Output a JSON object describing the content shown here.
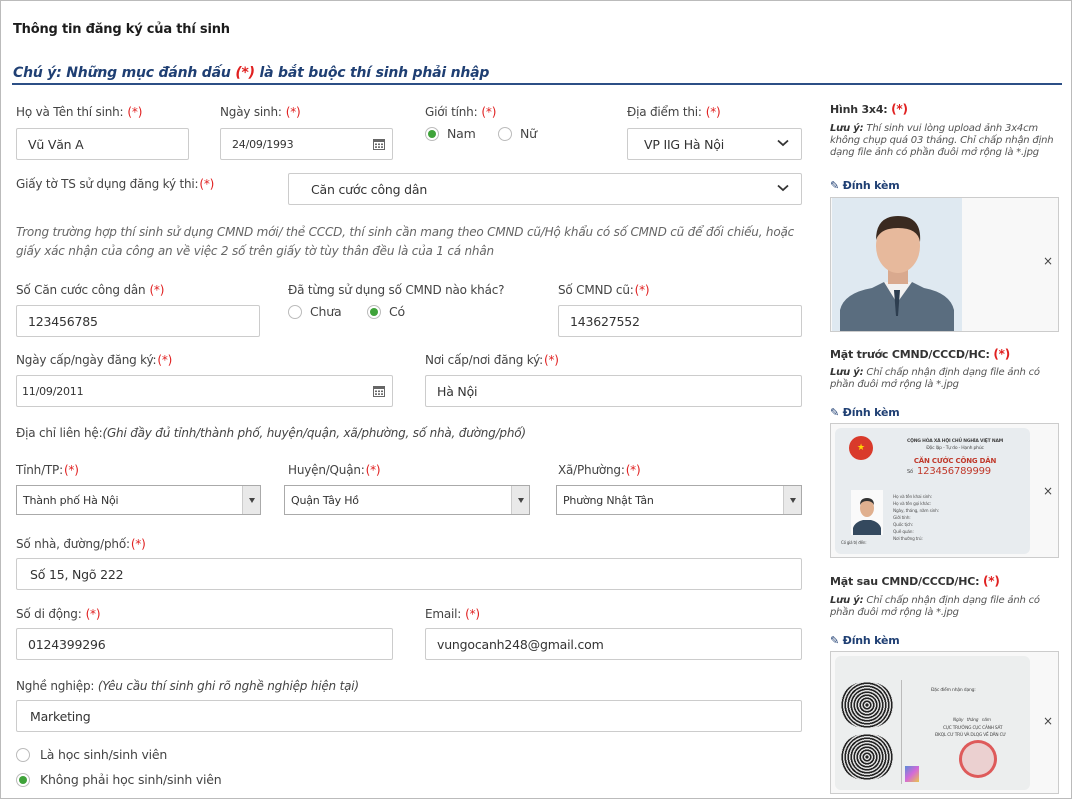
{
  "header": {
    "title": "Thông tin đăng ký của thí sinh"
  },
  "notice": {
    "prefix": "Chú ý: Những mục đánh dấu ",
    "star": "(*)",
    "suffix": " là bắt buộc thí sinh phải nhập"
  },
  "req": "(*)",
  "form": {
    "name": {
      "label": "Họ và Tên thí sinh:",
      "value": "Vũ Văn A"
    },
    "dob": {
      "label": "Ngày sinh:",
      "value": "24/09/1993"
    },
    "gender": {
      "label": "Giới tính:",
      "options": [
        "Nam",
        "Nữ"
      ],
      "selected": "Nam"
    },
    "location": {
      "label": "Địa điểm thi:",
      "value": "VP IIG Hà Nội"
    },
    "id_doc": {
      "label": "Giấy tờ TS sử dụng đăng ký thi:",
      "value": "Căn cước công dân"
    },
    "id_note": "Trong trường hợp thí sinh sử dụng CMND mới/ thẻ CCCD, thí sinh cần mang theo CMND cũ/Hộ khẩu có số CMND cũ để đối chiếu, hoặc giấy xác nhận của công an về việc 2 số trên giấy tờ tùy thân đều là của 1 cá nhân",
    "cccd": {
      "label": "Số Căn cước công dân",
      "value": "123456785"
    },
    "used_other": {
      "label": "Đã từng sử dụng số CMND nào khác?",
      "options": [
        "Chưa",
        "Có"
      ],
      "selected": "Có"
    },
    "old_id": {
      "label": "Số CMND cũ:",
      "value": "143627552"
    },
    "issue_date": {
      "label": "Ngày cấp/ngày đăng ký:",
      "value": "11/09/2011"
    },
    "issue_place": {
      "label": "Nơi cấp/nơi đăng ký:",
      "value": "Hà Nội"
    },
    "address_heading": {
      "label": "Địa chỉ liên hệ:",
      "hint": "(Ghi đầy đủ tỉnh/thành phố, huyện/quận, xã/phường, số nhà, đường/phố)"
    },
    "province": {
      "label": "Tỉnh/TP:",
      "value": "Thành phố Hà Nội"
    },
    "district": {
      "label": "Huyện/Quận:",
      "value": "Quận Tây Hồ"
    },
    "ward": {
      "label": "Xã/Phường:",
      "value": "Phường Nhật Tân"
    },
    "street": {
      "label": "Số nhà, đường/phố:",
      "value": "Số 15, Ngõ 222"
    },
    "phone": {
      "label": "Số di động:",
      "value": "0124399296"
    },
    "email": {
      "label": "Email:",
      "value": "vungocanh248@gmail.com"
    },
    "job": {
      "label": "Nghề nghiệp:",
      "hint": "(Yêu cầu thí sinh ghi rõ nghề nghiệp hiện tại)",
      "value": "Marketing"
    },
    "student": {
      "options": [
        "Là học sinh/sinh viên",
        "Không phải học sinh/sinh viên"
      ],
      "selected": "Không phải học sinh/sinh viên"
    }
  },
  "uploads": {
    "note_prefix": "Lưu ý:",
    "attach": "Đính kèm",
    "photo": {
      "title": "Hình 3x4:",
      "note": "Thí sinh vui lòng upload ảnh 3x4cm không chụp quá 03 tháng. Chỉ chấp nhận định dạng file ảnh có phần đuôi mở rộng là *.jpg"
    },
    "front": {
      "title": "Mặt trước CMND/CCCD/HC:",
      "note": "Chỉ chấp nhận định dạng file ảnh có phần đuôi mở rộng là *.jpg"
    },
    "back": {
      "title": "Mặt sau CMND/CCCD/HC:",
      "note": "Chỉ chấp nhận định dạng file ảnh có phần đuôi mở rộng là *.jpg"
    },
    "remove": "×",
    "card_front": {
      "l1": "CỘNG HÒA XÃ HỘI CHỦ NGHĨA VIỆT NAM",
      "l2": "Độc lập - Tự do - Hạnh phúc",
      "l3": "CĂN CƯỚC CÔNG DÂN",
      "l4": "Số",
      "l5": "123456789999",
      "fields": [
        "Họ và tên khai sinh:",
        "Họ và tên gọi khác:",
        "Ngày, tháng, năm sinh:",
        "Giới tính:",
        "Quốc tịch:",
        "Quê quán:",
        "Nơi thường trú:"
      ],
      "cap": "Có giá trị đến:"
    },
    "card_back": {
      "l1": "Đặc điểm nhận dạng:",
      "l2": "Ngày",
      "l2b": "tháng",
      "l2c": "năm",
      "l3": "CỤC TRƯỞNG CỤC CẢNH SÁT",
      "l4": "ĐKQL CƯ TRÚ VÀ DLQG VỀ DÂN CƯ"
    }
  }
}
